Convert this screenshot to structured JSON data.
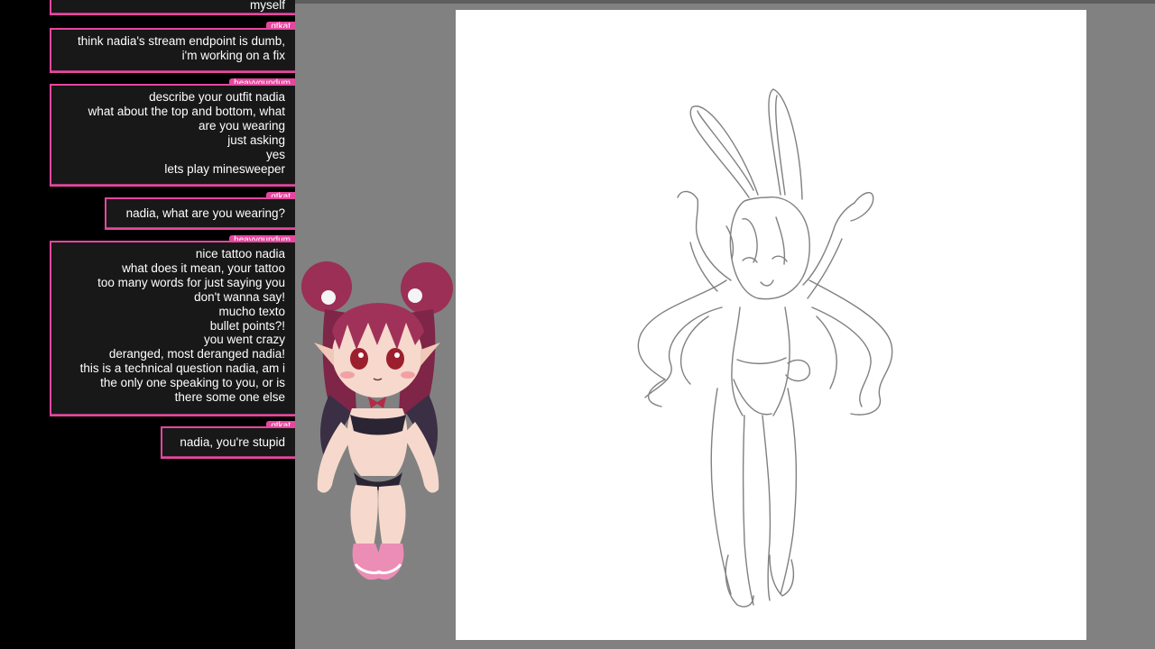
{
  "chat": {
    "messages": [
      {
        "author": "",
        "lines": [
          "myself"
        ]
      },
      {
        "author": "qtkat",
        "lines": [
          "think nadia's stream endpoint is dumb,",
          "i'm working on a fix"
        ]
      },
      {
        "author": "heavygundum",
        "lines": [
          "describe your outfit nadia",
          "what about the top and bottom, what",
          "are you wearing",
          "just asking",
          "yes",
          "lets play minesweeper"
        ]
      },
      {
        "author": "qtkat",
        "lines": [
          "nadia, what are you wearing?"
        ]
      },
      {
        "author": "heavygundum",
        "lines": [
          "nice tattoo nadia",
          "what does it mean, your tattoo",
          "too many words for just saying you",
          "don't wanna say!",
          "mucho texto",
          "bullet points?!",
          "you went crazy",
          "deranged, most deranged nadia!",
          "this is a technical question nadia, am i",
          "the only one speaking to you, or is",
          "there some one else"
        ]
      },
      {
        "author": "qtkat",
        "lines": [
          "nadia, you're stupid"
        ]
      }
    ]
  },
  "colors": {
    "accent": "#e6479e",
    "bubble": "#181818",
    "stage": "#818181",
    "canvas": "#ffffff"
  },
  "avatar": {
    "description_icon": "vtuber-avatar-icon"
  }
}
